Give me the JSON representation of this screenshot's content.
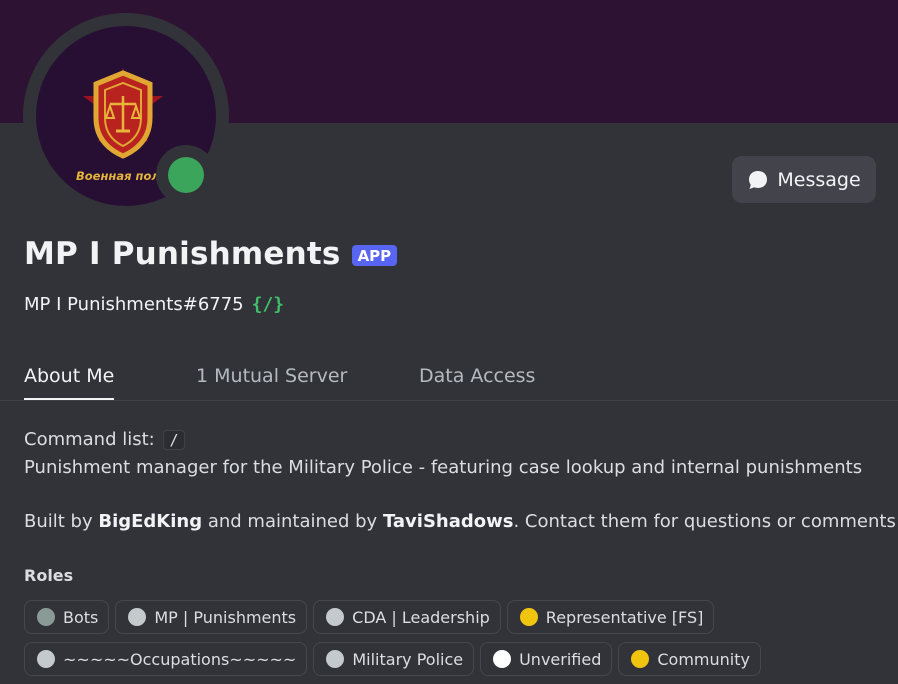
{
  "banner": {
    "color": "#2d1233"
  },
  "avatar": {
    "caption": "Военная полиц",
    "status": "online",
    "status_color": "#3ba55c"
  },
  "header": {
    "display_name": "MP I Punishments",
    "badge": "APP",
    "username": "MP I Punishments#6775",
    "command_icon": "{/}",
    "message_button": "Message"
  },
  "tabs": [
    {
      "label": "About Me",
      "active": true
    },
    {
      "label": "1 Mutual Server",
      "active": false
    },
    {
      "label": "Data Access",
      "active": false
    }
  ],
  "about": {
    "command_list_label": "Command list:",
    "command_list_value": "/",
    "description": "Punishment manager for the Military Police - featuring case lookup and internal punishments",
    "built_prefix": "Built by ",
    "builder": "BigEdKing",
    "maintained_text": " and maintained by ",
    "maintainer": "TaviShadows",
    "contact_text": ". Contact them for questions or comments"
  },
  "roles": {
    "heading": "Roles",
    "items": [
      {
        "name": "Bots",
        "color": "#8a9a96"
      },
      {
        "name": "MP | Punishments",
        "color": "#c4c9cc"
      },
      {
        "name": "CDA | Leadership",
        "color": "#c4c9cc"
      },
      {
        "name": "Representative [FS]",
        "color": "#f1c40f"
      },
      {
        "name": "~~~~~Occupations~~~~~",
        "color": "#c4c9cc"
      },
      {
        "name": "Military Police",
        "color": "#c4c9cc"
      },
      {
        "name": "Unverified",
        "color": "#ffffff"
      },
      {
        "name": "Community",
        "color": "#f1c40f"
      }
    ]
  }
}
